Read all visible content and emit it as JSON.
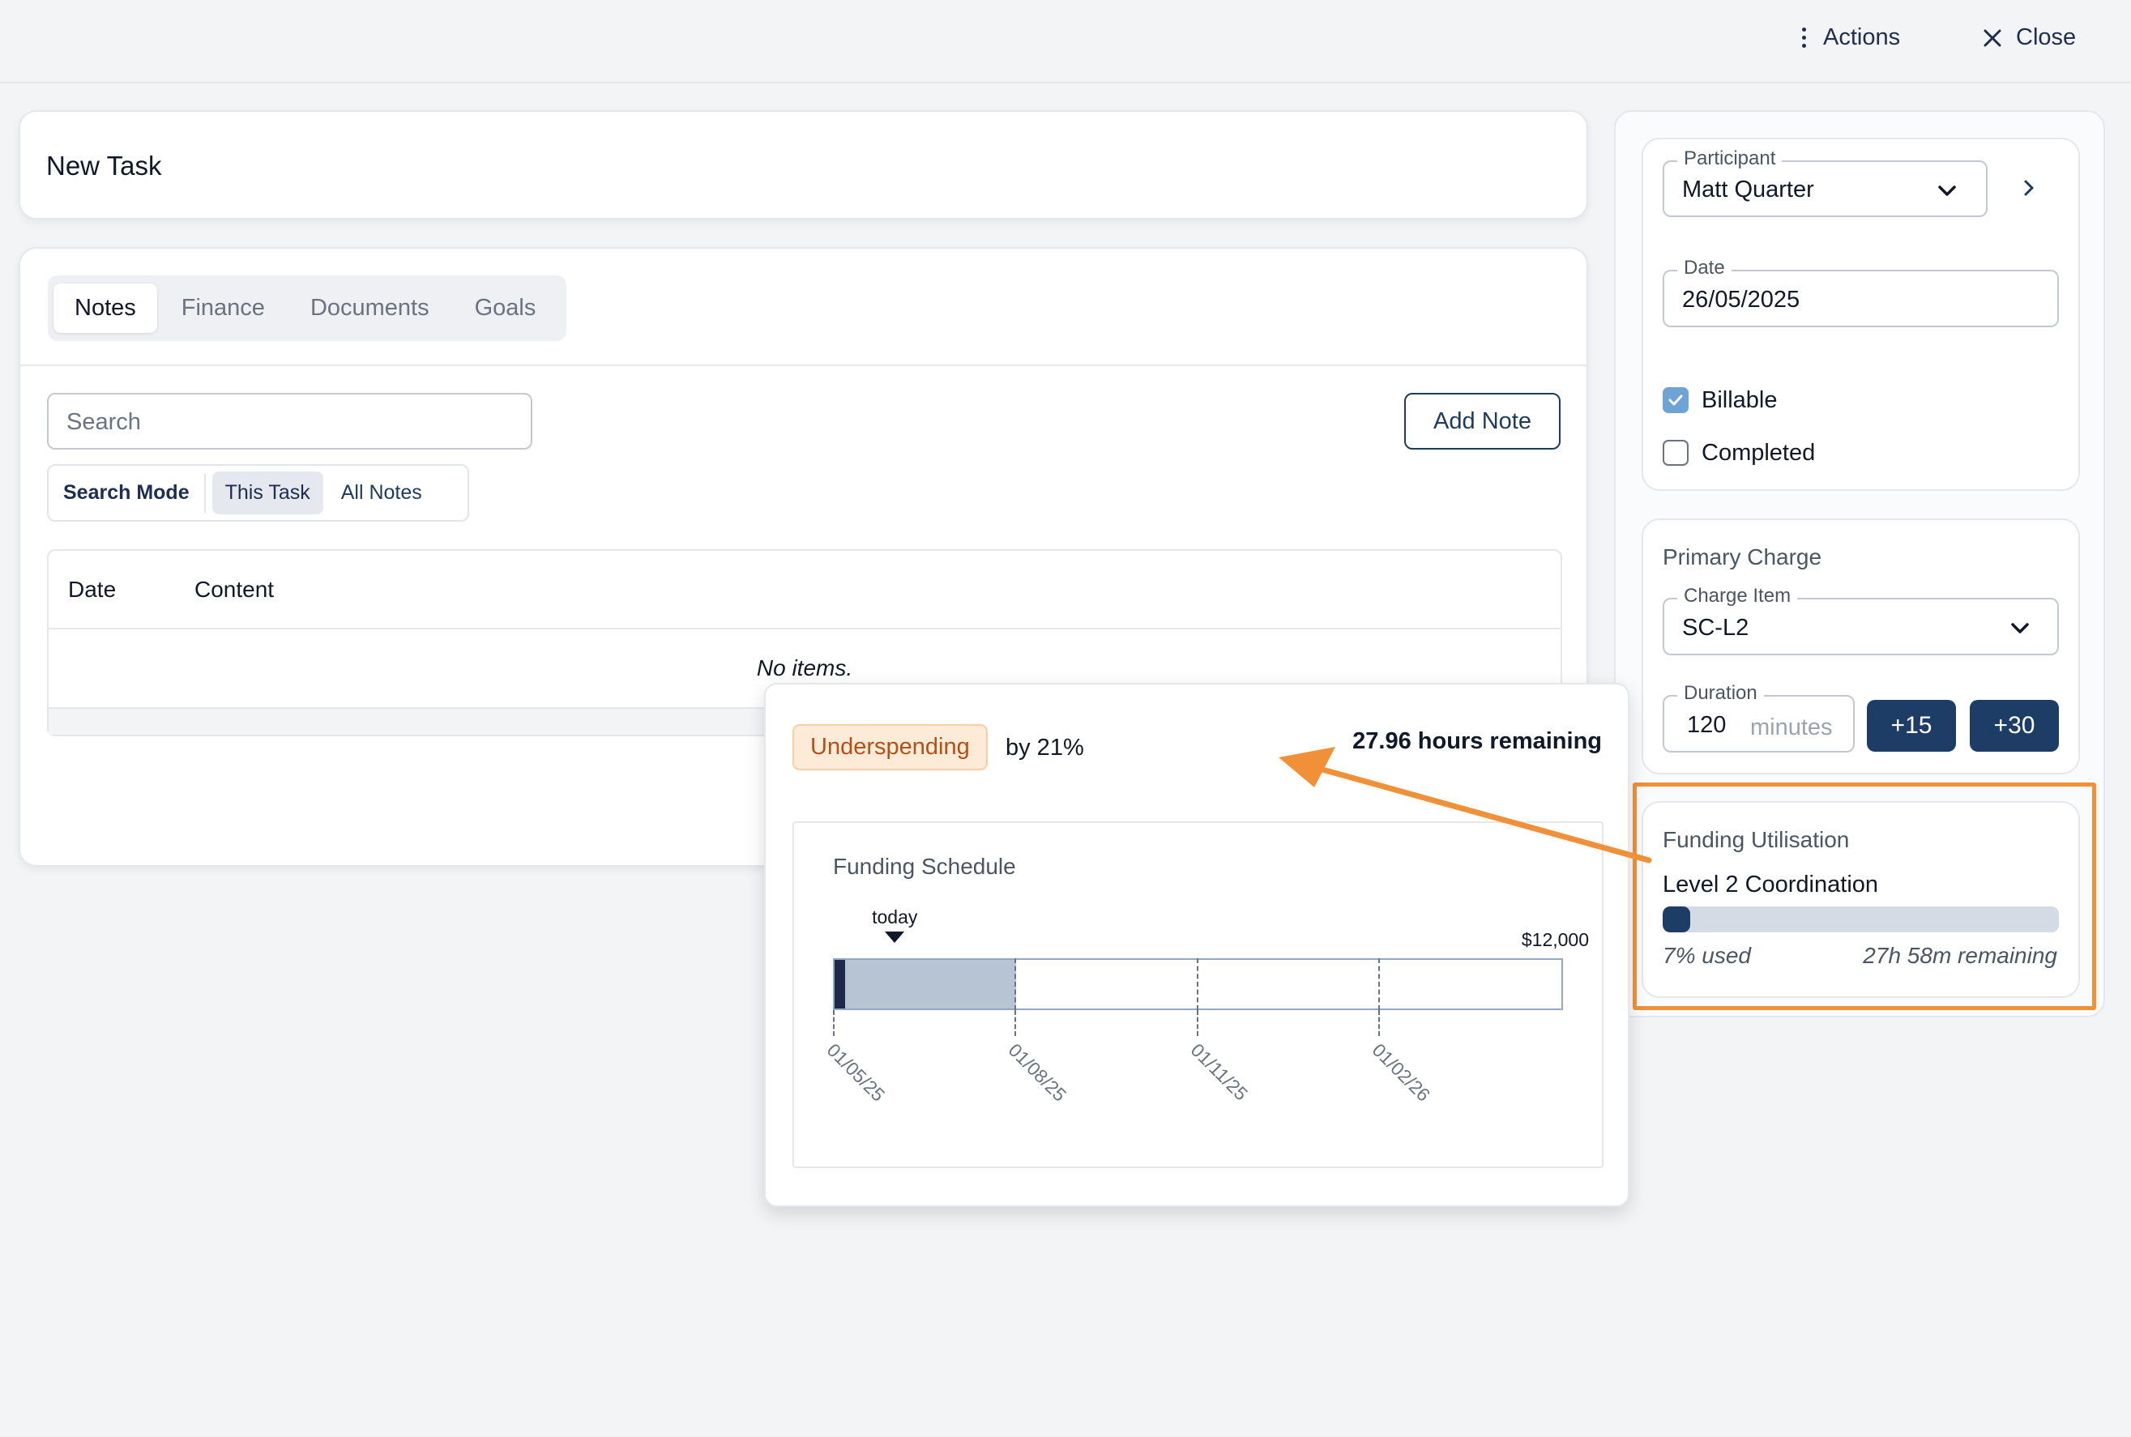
{
  "topbar": {
    "actions_label": "Actions",
    "close_label": "Close"
  },
  "task": {
    "title": "New Task"
  },
  "tabs": [
    {
      "label": "Notes",
      "active": true
    },
    {
      "label": "Finance",
      "active": false
    },
    {
      "label": "Documents",
      "active": false
    },
    {
      "label": "Goals",
      "active": false
    }
  ],
  "notes": {
    "search_placeholder": "Search",
    "add_note_label": "Add Note",
    "search_mode": {
      "label": "Search Mode",
      "options": [
        "This Task",
        "All Notes"
      ],
      "selected": "This Task"
    },
    "table": {
      "columns": [
        "Date",
        "Content"
      ],
      "empty_text": "No items."
    }
  },
  "side": {
    "participant": {
      "label": "Participant",
      "value": "Matt Quarter"
    },
    "date": {
      "label": "Date",
      "value": "26/05/2025"
    },
    "billable": {
      "label": "Billable",
      "checked": true
    },
    "completed": {
      "label": "Completed",
      "checked": false
    },
    "primary_charge": {
      "title": "Primary Charge",
      "charge_item": {
        "label": "Charge Item",
        "value": "SC-L2"
      },
      "duration": {
        "label": "Duration",
        "value": "120",
        "unit": "minutes"
      },
      "add15": "+15",
      "add30": "+30"
    },
    "funding": {
      "title": "Funding Utilisation",
      "item": "Level 2 Coordination",
      "used_fraction": 0.07,
      "used_label": "7% used",
      "remaining_label": "27h 58m remaining"
    }
  },
  "popup": {
    "badge": "Underspending",
    "by_text": "by 21%",
    "hours_remaining": "27.96 hours remaining",
    "schedule": {
      "title": "Funding Schedule",
      "today_label": "today",
      "max_label": "$12,000",
      "ticks": [
        "01/05/25",
        "01/08/25",
        "01/11/25",
        "01/02/26"
      ],
      "spent_fraction": 0.015,
      "elapsed_fraction": 0.25,
      "today_fraction": 0.085
    }
  },
  "colors": {
    "accent_navy": "#1d3d66",
    "highlight_orange": "#f0913a",
    "badge_bg": "#fdebd7",
    "badge_text": "#b4501a"
  }
}
